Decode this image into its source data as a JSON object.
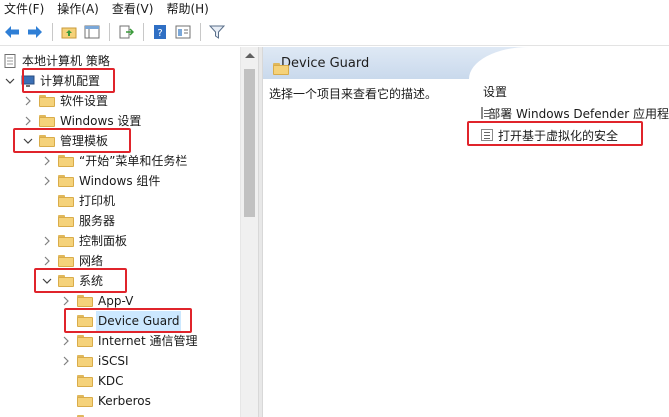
{
  "menu": {
    "items": [
      "文件(F)",
      "操作(A)",
      "查看(V)",
      "帮助(H)"
    ]
  },
  "toolbar": {
    "buttons": [
      "back-arrow-icon",
      "forward-arrow-icon",
      "up-folder-icon",
      "show-hide-tree-icon",
      "export-list-icon",
      "help-icon",
      "properties-icon",
      "filter-icon"
    ]
  },
  "tree": {
    "root": "本地计算机 策略",
    "computer_config": "计算机配置",
    "software_settings": "软件设置",
    "windows_settings": "Windows 设置",
    "admin_templates": "管理模板",
    "start_menu_taskbar": "“开始”菜单和任务栏",
    "windows_components": "Windows 组件",
    "printers": "打印机",
    "server": "服务器",
    "control_panel": "控制面板",
    "network": "网络",
    "system": "系统",
    "app_v": "App-V",
    "device_guard": "Device Guard",
    "internet_comm": "Internet 通信管理",
    "iscsi": "iSCSI",
    "kdc": "KDC",
    "kerberos": "Kerberos"
  },
  "right_pane": {
    "header_title": "Device Guard",
    "description": "选择一个项目来查看它的描述。",
    "settings_header": "设置",
    "settings": [
      "部署 Windows Defender 应用程",
      "打开基于虚拟化的安全"
    ]
  },
  "colors": {
    "highlight_box": "#e0242b",
    "selection_bg": "#cce8ff",
    "header_gradient_top": "#dfe9f5",
    "folder_yellow": "#f5d27a"
  }
}
